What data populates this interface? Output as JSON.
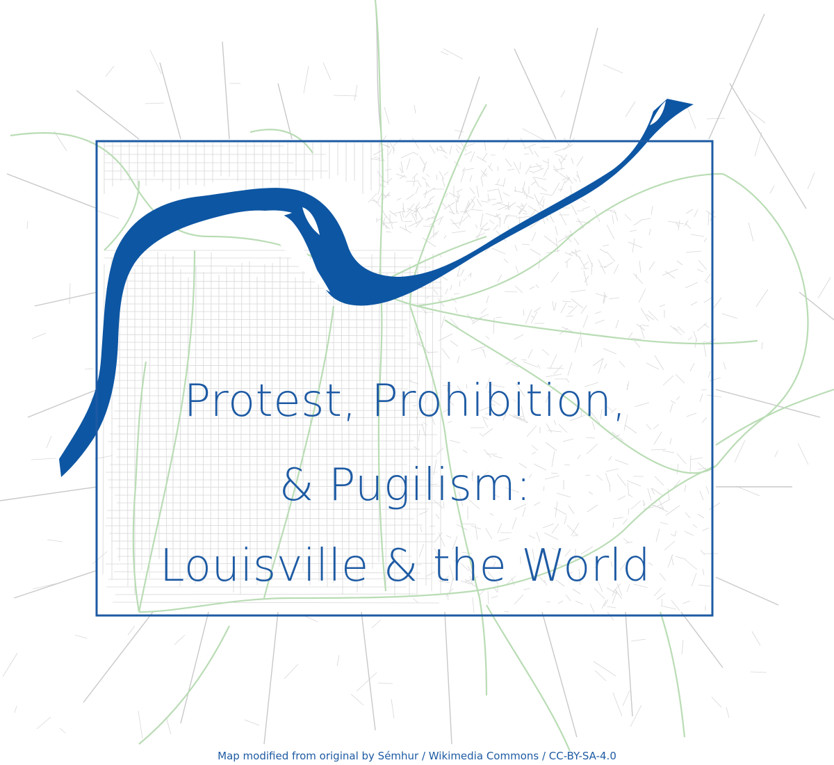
{
  "title": {
    "line1": "Protest, Prohibition,",
    "line2": "& Pugilism:",
    "line3": "Louisville & the World"
  },
  "credit": "Map modified from original by Sémhur / Wikimedia Commons / CC-BY-SA-4.0",
  "colors": {
    "river": "#0d56a3",
    "frame": "#1d5aa3",
    "title": "#1d5aa3",
    "streets": "#d4d4d4",
    "highways": "#b9dcb4",
    "background": "#ffffff"
  }
}
